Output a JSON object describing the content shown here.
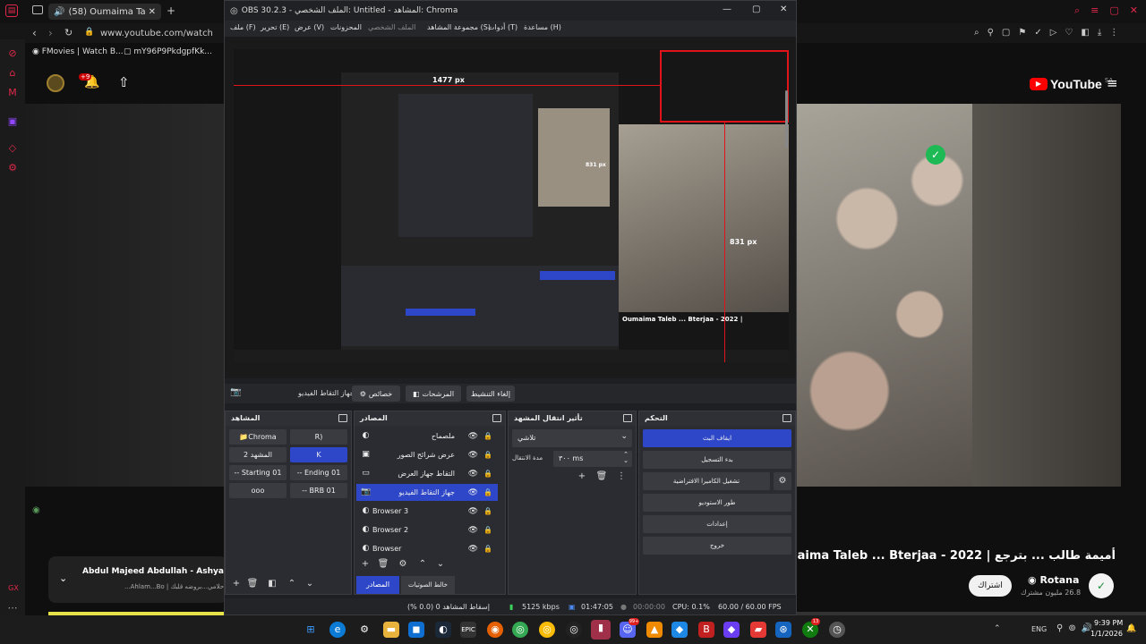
{
  "browser": {
    "tab_title": "(58) Oumaima Taleb | ...",
    "url": "www.youtube.com/watch",
    "bookmarks": [
      "FMovies | Watch B...",
      "mY96P9PkdgpfKk..."
    ],
    "notif_badge": "+9",
    "yt_logo": "YouTube",
    "yt_region": "SA",
    "sidebar_gx": "GX",
    "video_title": "أميمة طالب ... بترجع | Oumaima Taleb ... Bterjaa - 2022",
    "channel": "Rotana",
    "subs": "26.8 مليون مشترك",
    "subscribe": "اشتراك",
    "mini_title": "Abdul Majeed Abdullah - Ashyaa Te",
    "mini_sub": "أحلامي...بروضه قلبك | Ahlam...Bo...",
    "accent": "#e0284a"
  },
  "obs": {
    "title": "OBS 30.2.3 - الملف الشخصي: Untitled - المشاهد: Chroma",
    "menu": [
      "ملف (F)",
      "تحرير (E)",
      "عرض (V)",
      "المحزونات",
      "الملف الشخصي",
      "مجموعة المشاهد (S)",
      "أدوات (T)",
      "مساعدة (H)"
    ],
    "preview_labels": {
      "width": "1477 px",
      "height": "831 px",
      "height_inner": "831 px"
    },
    "ctx": {
      "source": "جهاز التقاط الفيديو",
      "properties": "خصائص",
      "filters": "المرشحات",
      "deactivate": "إلغاء التنشيط"
    },
    "docks": {
      "scenes": "المشاهد",
      "sources": "المصادر",
      "transitions": "تأثير انتقال المشهد",
      "controls": "التحكم"
    },
    "scenes": [
      [
        "Chroma",
        "R)"
      ],
      [
        "المشهد 2",
        "K"
      ],
      [
        "-- Starting 01",
        "-- Ending 01"
      ],
      [
        "ooo",
        "-- BRB 01"
      ]
    ],
    "sources": [
      "ملصماح",
      "عرض شرائح الصور",
      "التقاط جهاز العرض",
      "جهاز التقاط الفيديو",
      "Browser 3",
      "Browser 2",
      "Browser"
    ],
    "source_tabs": [
      "المصادر",
      "خالط الصوتيات"
    ],
    "transition": {
      "type": "تلاشي",
      "duration_label": "مدة الانتقال",
      "duration": "٣٠٠ ms"
    },
    "controls": [
      "ايقاف البث",
      "بدء التسجيل",
      "تشغيل الكاميرا الافتراضية",
      "طور الاستوديو",
      "إعدادات",
      "خروج"
    ],
    "status": {
      "dropped": "إسقاط المشاهد 0 (0.0 %)",
      "bitrate": "5125 kbps",
      "live": "01:47:05",
      "rec": "00:00:00",
      "cpu": "CPU: 0.1%",
      "fps": "60.00 / 60.00 FPS"
    },
    "colors": {
      "selected": "#2d47c8",
      "marker": "#e0121a"
    }
  },
  "taskbar": {
    "lang": "ENG",
    "time": "9:39 PM",
    "date": "1/1/2026",
    "badges": [
      "99+",
      "13"
    ]
  }
}
